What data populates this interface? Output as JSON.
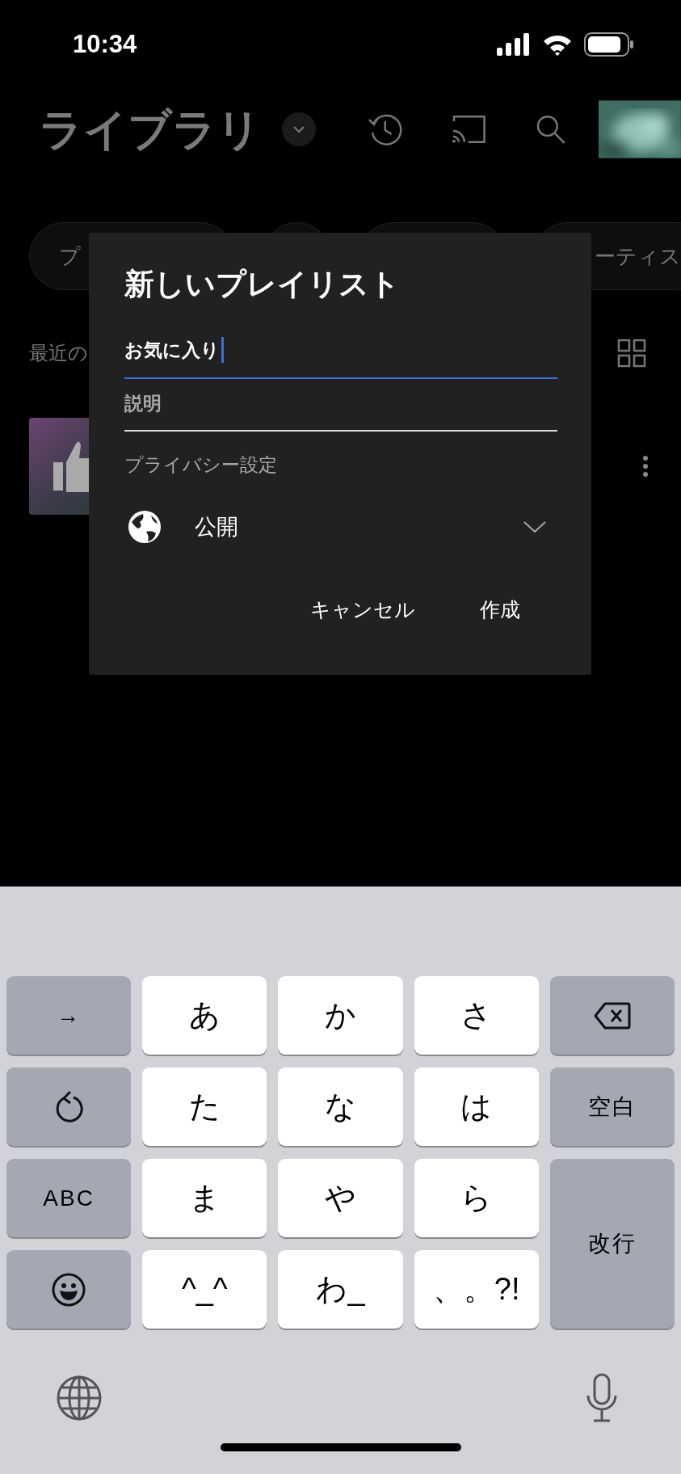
{
  "status_bar": {
    "time": "10:34"
  },
  "header": {
    "title": "ライブラリ"
  },
  "chips": [
    {
      "kind": "labeled",
      "label": "プ"
    },
    {
      "kind": "covered"
    },
    {
      "kind": "covered"
    },
    {
      "kind": "labeled",
      "label": "ーティス"
    }
  ],
  "section": {
    "title": "最近の"
  },
  "dialog": {
    "title": "新しいプレイリスト",
    "name_field": {
      "value": "お気に入り",
      "focused": true
    },
    "description_field": {
      "placeholder": "説明",
      "focused": false
    },
    "privacy_label": "プライバシー設定",
    "privacy_value": "公開",
    "buttons": [
      "キャンセル",
      "作成"
    ]
  },
  "keyboard": {
    "keys": [
      {
        "kind": "function",
        "label": "→"
      },
      {
        "kind": "letter",
        "label": "あ"
      },
      {
        "kind": "letter",
        "label": "か"
      },
      {
        "kind": "letter",
        "label": "さ"
      },
      {
        "kind": "delete"
      },
      {
        "kind": "undo"
      },
      {
        "kind": "letter",
        "label": "た"
      },
      {
        "kind": "letter",
        "label": "な"
      },
      {
        "kind": "letter",
        "label": "は"
      },
      {
        "kind": "function",
        "label": "空白"
      },
      {
        "kind": "function",
        "label": "ABC"
      },
      {
        "kind": "letter",
        "label": "ま"
      },
      {
        "kind": "letter",
        "label": "や"
      },
      {
        "kind": "letter",
        "label": "ら"
      },
      {
        "kind": "return",
        "label": "改行"
      },
      {
        "kind": "emoji"
      },
      {
        "kind": "letter",
        "label": "^_^"
      },
      {
        "kind": "letter",
        "label": "わ_"
      },
      {
        "kind": "letter",
        "label": "、。?!"
      }
    ]
  }
}
